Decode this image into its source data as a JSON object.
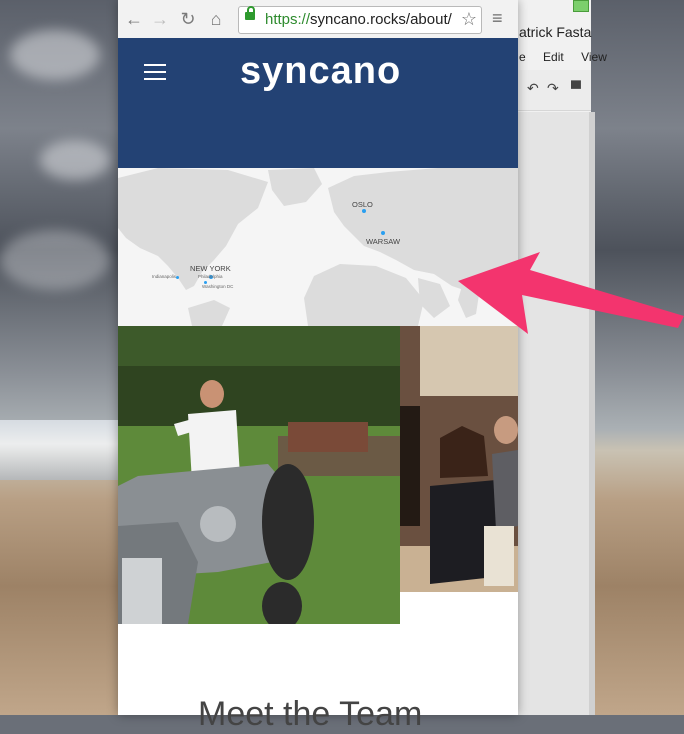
{
  "browser": {
    "url_scheme": "https://",
    "url_rest": "syncano.rocks/about/"
  },
  "site": {
    "logo_text": "syncano",
    "map_cities": [
      "OSLO",
      "WARSAW",
      "NEW YORK"
    ],
    "map_small_cities": [
      "Indianapolis",
      "Philadelphia",
      "Washington DC"
    ],
    "section_heading": "Meet the Team"
  },
  "background_app": {
    "title": "atrick Fasta",
    "menu": [
      "e",
      "Edit",
      "View"
    ]
  },
  "colors": {
    "header_bg": "#234274",
    "arrow": "#f3346e",
    "map_dot": "#2a9ff0"
  }
}
